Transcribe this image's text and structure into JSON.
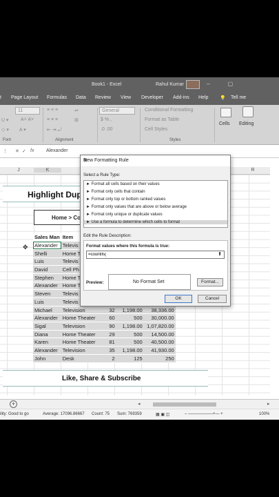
{
  "window": {
    "title": "Book1 - Excel",
    "user": "Rahul Kumar",
    "tell_me": "Tell me"
  },
  "tabs": [
    "t",
    "Page Layout",
    "Formulas",
    "Data",
    "Review",
    "View",
    "Developer",
    "Add-ins",
    "Help"
  ],
  "ribbon": {
    "font_size": "11",
    "number_format": "General",
    "conditional_formatting": "Conditional Formatting",
    "format_as_table": "Format as Table",
    "cell_styles": "Cell Styles",
    "cells": "Cells",
    "editing": "Editing",
    "groups": {
      "font": "Font",
      "alignment": "Alignment",
      "styles": "Styles"
    }
  },
  "formula_bar": {
    "value": "Alexander"
  },
  "columns": [
    "J",
    "K",
    "R"
  ],
  "sheet": {
    "heading": "Highlight Dupl",
    "breadcrumb": "Home > Co",
    "headers": [
      "Sales Man",
      "Item"
    ],
    "rows": [
      [
        "Alexander",
        "Televis",
        "",
        "",
        ""
      ],
      [
        "Shelli",
        "Home T",
        "",
        "",
        ""
      ],
      [
        "Luis",
        "Televis",
        "",
        "",
        ""
      ],
      [
        "David",
        "Cell Ph",
        "",
        "",
        ""
      ],
      [
        "Stephen",
        "Home T",
        "",
        "",
        ""
      ],
      [
        "Alexander",
        "Home T",
        "",
        "",
        ""
      ],
      [
        "Steven",
        "Televis",
        "",
        "",
        ""
      ],
      [
        "Luis",
        "Televis",
        "",
        "",
        ""
      ],
      [
        "Michael",
        "Television",
        "32",
        "1,198.00",
        "38,336.00"
      ],
      [
        "Alexander",
        "Home Theater",
        "60",
        "500",
        "30,000.00"
      ],
      [
        "Sigal",
        "Television",
        "90",
        "1,198.00",
        "1,07,820.00"
      ],
      [
        "Diana",
        "Home Theater",
        "29",
        "500",
        "14,500.00"
      ],
      [
        "Karen",
        "Home Theater",
        "81",
        "500",
        "40,500.00"
      ],
      [
        "Alexander",
        "Television",
        "35",
        "1,198.00",
        "41,930.00"
      ],
      [
        "John",
        "Desk",
        "2",
        "125",
        "250"
      ]
    ],
    "footer": "Like, Share & Subscribe"
  },
  "status": {
    "ready": "ility: Good to go",
    "average": "Average: 17096.86667",
    "count": "Count: 75",
    "sum": "Sum: 769359",
    "zoom": "100%"
  },
  "dialog": {
    "title": "New Formatting Rule",
    "help": "?",
    "close": "✕",
    "select_label": "Select a Rule Type:",
    "rule_types": [
      "► Format all cells based on their values",
      "► Format only cells that contain",
      "► Format only top or bottom ranked values",
      "► Format only values that are above or below average",
      "► Format only unique or duplicate values",
      "► Use a formula to determine which cells to format"
    ],
    "edit_label": "Edit the Rule Description:",
    "formula_label": "Format values where this formula is true:",
    "formula_value": "=countifs(",
    "preview_label": "Preview:",
    "preview_text": "No Format Set",
    "format_button": "Format...",
    "ok": "OK",
    "cancel": "Cancel"
  }
}
